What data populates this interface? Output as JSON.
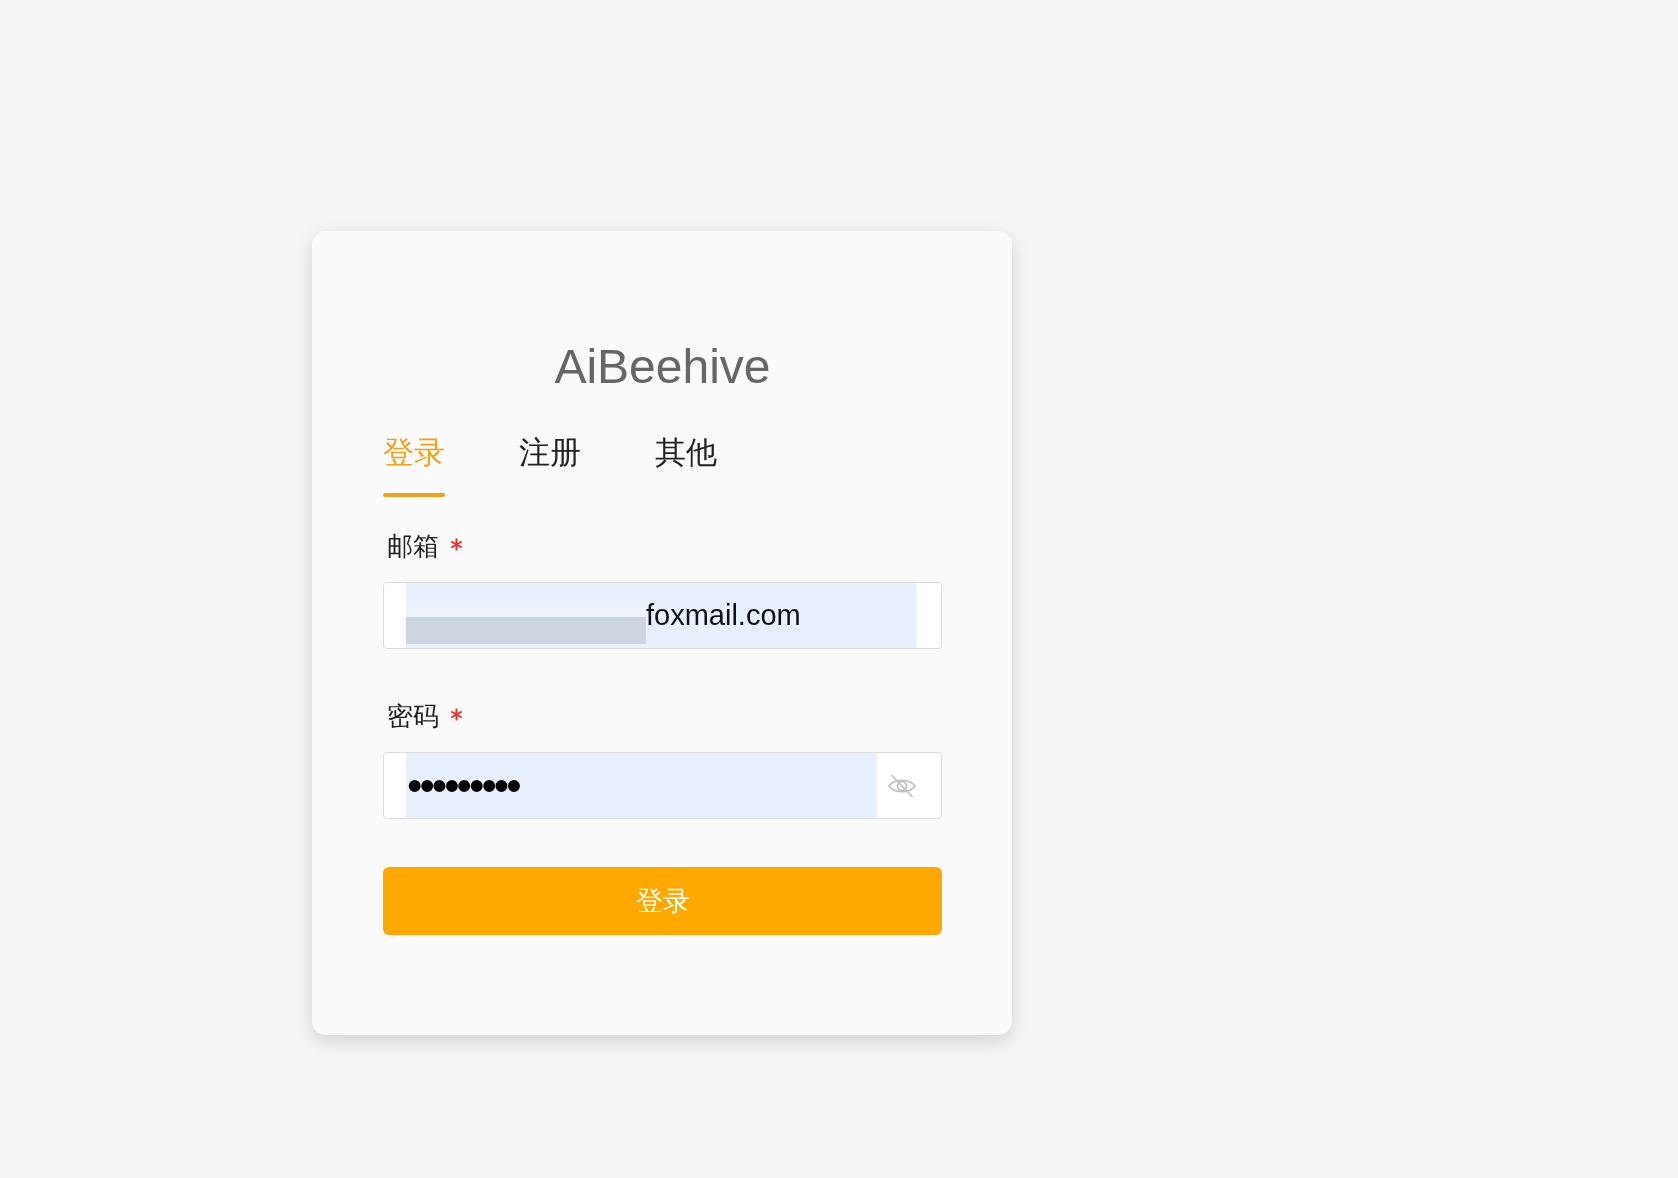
{
  "app": {
    "title": "AiBeehive"
  },
  "tabs": [
    {
      "label": "登录",
      "selected": true
    },
    {
      "label": "注册",
      "selected": false
    },
    {
      "label": "其他",
      "selected": false
    }
  ],
  "form": {
    "fields": [
      {
        "kind": "email",
        "label": "邮箱",
        "required": true,
        "redacted": true,
        "value": "foxmail.com",
        "autofilled": true
      },
      {
        "kind": "password",
        "label": "密码",
        "required": true,
        "value": "•••••••••",
        "autofilled": true
      }
    ],
    "submit_button": "登录"
  }
}
